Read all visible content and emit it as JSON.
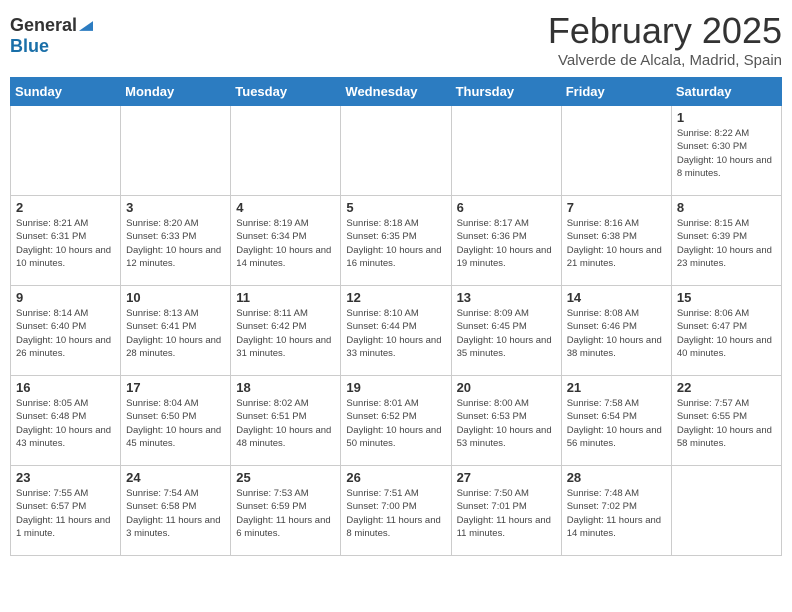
{
  "logo": {
    "general": "General",
    "blue": "Blue"
  },
  "title": "February 2025",
  "subtitle": "Valverde de Alcala, Madrid, Spain",
  "weekdays": [
    "Sunday",
    "Monday",
    "Tuesday",
    "Wednesday",
    "Thursday",
    "Friday",
    "Saturday"
  ],
  "weeks": [
    [
      {
        "day": "",
        "info": ""
      },
      {
        "day": "",
        "info": ""
      },
      {
        "day": "",
        "info": ""
      },
      {
        "day": "",
        "info": ""
      },
      {
        "day": "",
        "info": ""
      },
      {
        "day": "",
        "info": ""
      },
      {
        "day": "1",
        "info": "Sunrise: 8:22 AM\nSunset: 6:30 PM\nDaylight: 10 hours and 8 minutes."
      }
    ],
    [
      {
        "day": "2",
        "info": "Sunrise: 8:21 AM\nSunset: 6:31 PM\nDaylight: 10 hours and 10 minutes."
      },
      {
        "day": "3",
        "info": "Sunrise: 8:20 AM\nSunset: 6:33 PM\nDaylight: 10 hours and 12 minutes."
      },
      {
        "day": "4",
        "info": "Sunrise: 8:19 AM\nSunset: 6:34 PM\nDaylight: 10 hours and 14 minutes."
      },
      {
        "day": "5",
        "info": "Sunrise: 8:18 AM\nSunset: 6:35 PM\nDaylight: 10 hours and 16 minutes."
      },
      {
        "day": "6",
        "info": "Sunrise: 8:17 AM\nSunset: 6:36 PM\nDaylight: 10 hours and 19 minutes."
      },
      {
        "day": "7",
        "info": "Sunrise: 8:16 AM\nSunset: 6:38 PM\nDaylight: 10 hours and 21 minutes."
      },
      {
        "day": "8",
        "info": "Sunrise: 8:15 AM\nSunset: 6:39 PM\nDaylight: 10 hours and 23 minutes."
      }
    ],
    [
      {
        "day": "9",
        "info": "Sunrise: 8:14 AM\nSunset: 6:40 PM\nDaylight: 10 hours and 26 minutes."
      },
      {
        "day": "10",
        "info": "Sunrise: 8:13 AM\nSunset: 6:41 PM\nDaylight: 10 hours and 28 minutes."
      },
      {
        "day": "11",
        "info": "Sunrise: 8:11 AM\nSunset: 6:42 PM\nDaylight: 10 hours and 31 minutes."
      },
      {
        "day": "12",
        "info": "Sunrise: 8:10 AM\nSunset: 6:44 PM\nDaylight: 10 hours and 33 minutes."
      },
      {
        "day": "13",
        "info": "Sunrise: 8:09 AM\nSunset: 6:45 PM\nDaylight: 10 hours and 35 minutes."
      },
      {
        "day": "14",
        "info": "Sunrise: 8:08 AM\nSunset: 6:46 PM\nDaylight: 10 hours and 38 minutes."
      },
      {
        "day": "15",
        "info": "Sunrise: 8:06 AM\nSunset: 6:47 PM\nDaylight: 10 hours and 40 minutes."
      }
    ],
    [
      {
        "day": "16",
        "info": "Sunrise: 8:05 AM\nSunset: 6:48 PM\nDaylight: 10 hours and 43 minutes."
      },
      {
        "day": "17",
        "info": "Sunrise: 8:04 AM\nSunset: 6:50 PM\nDaylight: 10 hours and 45 minutes."
      },
      {
        "day": "18",
        "info": "Sunrise: 8:02 AM\nSunset: 6:51 PM\nDaylight: 10 hours and 48 minutes."
      },
      {
        "day": "19",
        "info": "Sunrise: 8:01 AM\nSunset: 6:52 PM\nDaylight: 10 hours and 50 minutes."
      },
      {
        "day": "20",
        "info": "Sunrise: 8:00 AM\nSunset: 6:53 PM\nDaylight: 10 hours and 53 minutes."
      },
      {
        "day": "21",
        "info": "Sunrise: 7:58 AM\nSunset: 6:54 PM\nDaylight: 10 hours and 56 minutes."
      },
      {
        "day": "22",
        "info": "Sunrise: 7:57 AM\nSunset: 6:55 PM\nDaylight: 10 hours and 58 minutes."
      }
    ],
    [
      {
        "day": "23",
        "info": "Sunrise: 7:55 AM\nSunset: 6:57 PM\nDaylight: 11 hours and 1 minute."
      },
      {
        "day": "24",
        "info": "Sunrise: 7:54 AM\nSunset: 6:58 PM\nDaylight: 11 hours and 3 minutes."
      },
      {
        "day": "25",
        "info": "Sunrise: 7:53 AM\nSunset: 6:59 PM\nDaylight: 11 hours and 6 minutes."
      },
      {
        "day": "26",
        "info": "Sunrise: 7:51 AM\nSunset: 7:00 PM\nDaylight: 11 hours and 8 minutes."
      },
      {
        "day": "27",
        "info": "Sunrise: 7:50 AM\nSunset: 7:01 PM\nDaylight: 11 hours and 11 minutes."
      },
      {
        "day": "28",
        "info": "Sunrise: 7:48 AM\nSunset: 7:02 PM\nDaylight: 11 hours and 14 minutes."
      },
      {
        "day": "",
        "info": ""
      }
    ]
  ]
}
